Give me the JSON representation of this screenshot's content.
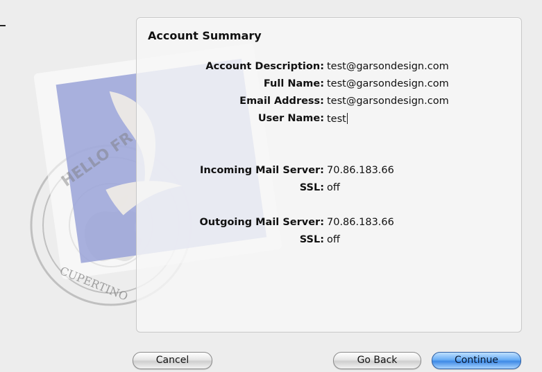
{
  "summary": {
    "title": "Account Summary",
    "rows": [
      {
        "label": "Account Description:",
        "value": "test@garsondesign.com"
      },
      {
        "label": "Full Name:",
        "value": "test@garsondesign.com"
      },
      {
        "label": "Email Address:",
        "value": "test@garsondesign.com"
      },
      {
        "label": "User Name:",
        "value": "test"
      },
      {
        "label": "Incoming Mail Server:",
        "value": "70.86.183.66"
      },
      {
        "label": "SSL:",
        "value": "off"
      },
      {
        "label": "Outgoing Mail Server:",
        "value": "70.86.183.66"
      },
      {
        "label": "SSL:",
        "value": "off"
      }
    ]
  },
  "stamp": {
    "postmark_top": "HELLO FR",
    "postmark_bottom": "CUPERTINO"
  },
  "buttons": {
    "cancel": "Cancel",
    "go_back": "Go Back",
    "continue": "Continue"
  },
  "colors": {
    "accent": "#4a8fe6",
    "stamp": "#9aa3d8"
  }
}
